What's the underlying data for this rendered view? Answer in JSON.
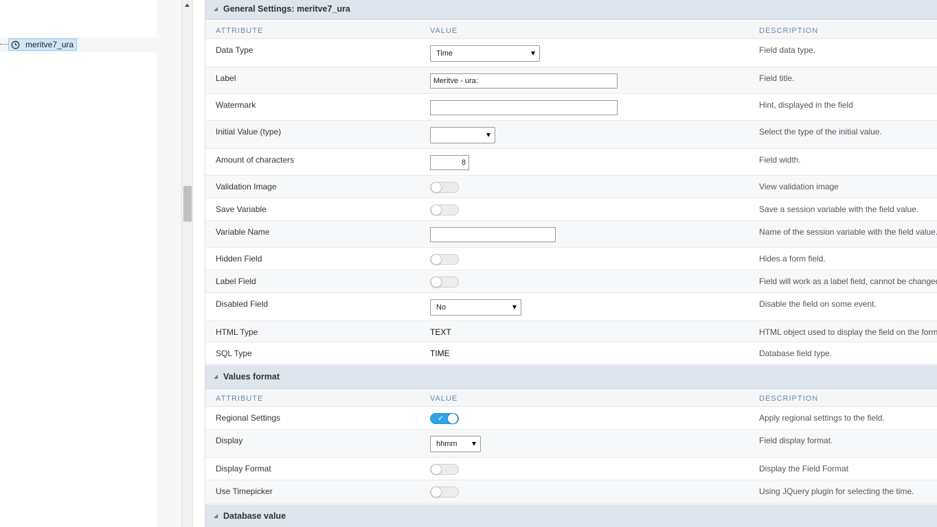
{
  "tree": {
    "node_label": "meritve7_ura"
  },
  "general": {
    "title": "General Settings: meritve7_ura",
    "headers": {
      "attribute": "ATTRIBUTE",
      "value": "VALUE",
      "description": "DESCRIPTION"
    },
    "rows": [
      {
        "attr": "Data Type",
        "value": "Time",
        "desc": "Field data type."
      },
      {
        "attr": "Label",
        "value": "Meritve - ura:",
        "desc": "Field title."
      },
      {
        "attr": "Watermark",
        "value": "",
        "desc": "Hint, displayed in the field"
      },
      {
        "attr": "Initial Value (type)",
        "value": "",
        "desc": "Select the type of the initial value."
      },
      {
        "attr": "Amount of characters",
        "value": "8",
        "desc": "Field width."
      },
      {
        "attr": "Validation Image",
        "value": "off",
        "desc": "View validation image"
      },
      {
        "attr": "Save Variable",
        "value": "off",
        "desc": "Save a session variable with the field value."
      },
      {
        "attr": "Variable Name",
        "value": "",
        "desc": "Name of the session variable with the field value."
      },
      {
        "attr": "Hidden Field",
        "value": "off",
        "desc": "Hides a form field."
      },
      {
        "attr": "Label Field",
        "value": "off",
        "desc": "Field will work as a label field, cannot be changed"
      },
      {
        "attr": "Disabled Field",
        "value": "No",
        "desc": "Disable the field on some event."
      },
      {
        "attr": "HTML Type",
        "value": "TEXT",
        "desc": "HTML object used to display the field on the form"
      },
      {
        "attr": "SQL Type",
        "value": "TIME",
        "desc": "Database field type."
      }
    ]
  },
  "values_format": {
    "title": "Values format",
    "headers": {
      "attribute": "ATTRIBUTE",
      "value": "VALUE",
      "description": "DESCRIPTION"
    },
    "rows": [
      {
        "attr": "Regional Settings",
        "value": "on",
        "desc": "Apply regional settings to the field."
      },
      {
        "attr": "Display",
        "value": "hhmm",
        "desc": "Field display format."
      },
      {
        "attr": "Display Format",
        "value": "off",
        "desc": "Display the Field Format"
      },
      {
        "attr": "Use Timepicker",
        "value": "off",
        "desc": "Using JQuery plugin for selecting the time."
      }
    ]
  },
  "database_value": {
    "title": "Database value"
  },
  "colors": {
    "accent": "#2fa2e8",
    "section_bg": "#dfe5ec",
    "header_text": "#6c8aa2"
  }
}
